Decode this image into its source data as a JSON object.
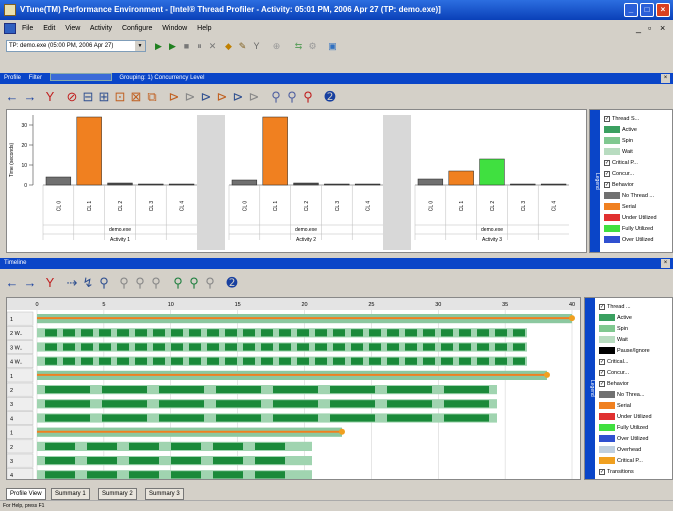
{
  "window": {
    "title": "VTune(TM) Performance Environment - [Intel® Thread Profiler - Activity: 05:01 PM, 2006 Apr 27 (TP: demo.exe)]"
  },
  "menu": [
    "File",
    "Edit",
    "View",
    "Activity",
    "Configure",
    "Window",
    "Help"
  ],
  "toolbar": {
    "activity_combo": "TP: demo.exe (05:00 PM, 2006 Apr 27)"
  },
  "profile_pane": {
    "title": "Profile",
    "filter_label": "Filter",
    "grouping_label": "Grouping: 1) Concurrency Level"
  },
  "timeline_pane": {
    "title": "Timeline"
  },
  "chart_data": {
    "type": "bar",
    "ylabel": "Time (seconds)",
    "yticks": [
      "30",
      "20",
      "10",
      "0"
    ],
    "ylim": [
      0,
      35
    ],
    "groups": [
      {
        "name": "Activity 1",
        "exe": "demo.exe",
        "categories": [
          "CL 0",
          "CL 1",
          "CL 2",
          "CL 3",
          "CL 4"
        ],
        "values": [
          4,
          34,
          1,
          0.5,
          0.5
        ],
        "colors": [
          "#707070",
          "#f08020",
          "#505050",
          "#505050",
          "#505050"
        ]
      },
      {
        "name": "Activity 2",
        "exe": "demo.exe",
        "categories": [
          "CL 0",
          "CL 1",
          "CL 2",
          "CL 3",
          "CL 4"
        ],
        "values": [
          2.5,
          34,
          1,
          0.5,
          0.5
        ],
        "colors": [
          "#707070",
          "#f08020",
          "#505050",
          "#505050",
          "#505050"
        ]
      },
      {
        "name": "Activity 3",
        "exe": "demo.exe",
        "categories": [
          "CL 0",
          "CL 1",
          "CL 2",
          "CL 3",
          "CL 4"
        ],
        "values": [
          3,
          7,
          13,
          0.5,
          0.5
        ],
        "colors": [
          "#707070",
          "#f08020",
          "#40e040",
          "#505050",
          "#505050"
        ]
      }
    ]
  },
  "profile_legend": {
    "band": "Legend",
    "items": [
      "Thread S...",
      "Active",
      "Spin",
      "Wait",
      "Critical P...",
      "Concur...",
      "Behavior",
      "No Thread ...",
      "Serial",
      "Under Utilized",
      "Fully Utilized",
      "Over Utilized"
    ],
    "colors": [
      "",
      "#3aa060",
      "#80c890",
      "#b8dcc0",
      "",
      "",
      "",
      "#707070",
      "#f08020",
      "#e03030",
      "#40e040",
      "#3050d0"
    ]
  },
  "timeline": {
    "ticks": [
      "0",
      "5",
      "10",
      "15",
      "20",
      "25",
      "30",
      "35",
      "40"
    ],
    "row_labels": [
      "1",
      "2 W..",
      "3 W..",
      "4 W..",
      "1",
      "2",
      "3",
      "4",
      "1",
      "2",
      "3",
      "4"
    ]
  },
  "timeline_legend": {
    "band": "Legend",
    "items": [
      "Thread ...",
      "Active",
      "Spin",
      "Wait",
      "Pause/Ignore",
      "Critical...",
      "Concur...",
      "Behavior",
      "No Threa...",
      "Serial",
      "Under Utilized",
      "Fully Utilized",
      "Over Utilized",
      "Overhead",
      "Critical P...",
      "Transitions"
    ],
    "colors": [
      "",
      "#3aa060",
      "#80c890",
      "#b8dcc0",
      "#000000",
      "",
      "",
      "",
      "#707070",
      "#f08020",
      "#e03030",
      "#40e040",
      "#3050d0",
      "#c0d0e0",
      "#f0a020",
      ""
    ]
  },
  "tabs": [
    "Profile View",
    "Summary 1",
    "Summary 2",
    "Summary 3"
  ],
  "status": "For Help, press F1"
}
